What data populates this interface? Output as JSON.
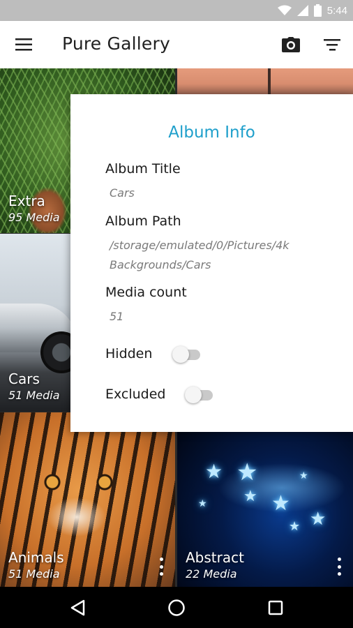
{
  "status_bar": {
    "time": "5:44",
    "icons": [
      "wifi-icon",
      "signal-icon",
      "battery-icon"
    ]
  },
  "app_bar": {
    "title": "Pure Gallery",
    "icons": [
      "menu-icon",
      "camera-icon",
      "sort-icon"
    ]
  },
  "albums": [
    {
      "name": "Extra",
      "count": "95 Media"
    },
    {
      "name": "Cars",
      "count": "51 Media"
    },
    {
      "name": "Animals",
      "count": "51 Media"
    },
    {
      "name": "Abstract",
      "count": "22 Media"
    }
  ],
  "dialog": {
    "title": "Album Info",
    "album_title_label": "Album Title",
    "album_title_value": "Cars",
    "album_path_label": "Album Path",
    "album_path_value": "/storage/emulated/0/Pictures/4k Backgrounds/Cars",
    "media_count_label": "Media count",
    "media_count_value": "51",
    "hidden_label": "Hidden",
    "hidden_on": false,
    "excluded_label": "Excluded",
    "excluded_on": false
  },
  "nav_bar": {
    "icons": [
      "back-icon",
      "home-icon",
      "recents-icon"
    ]
  },
  "colors": {
    "accent": "#1e9fcb",
    "status_bar": "#bdbdbd",
    "app_bar": "#ffffff",
    "nav_bar": "#000000"
  }
}
